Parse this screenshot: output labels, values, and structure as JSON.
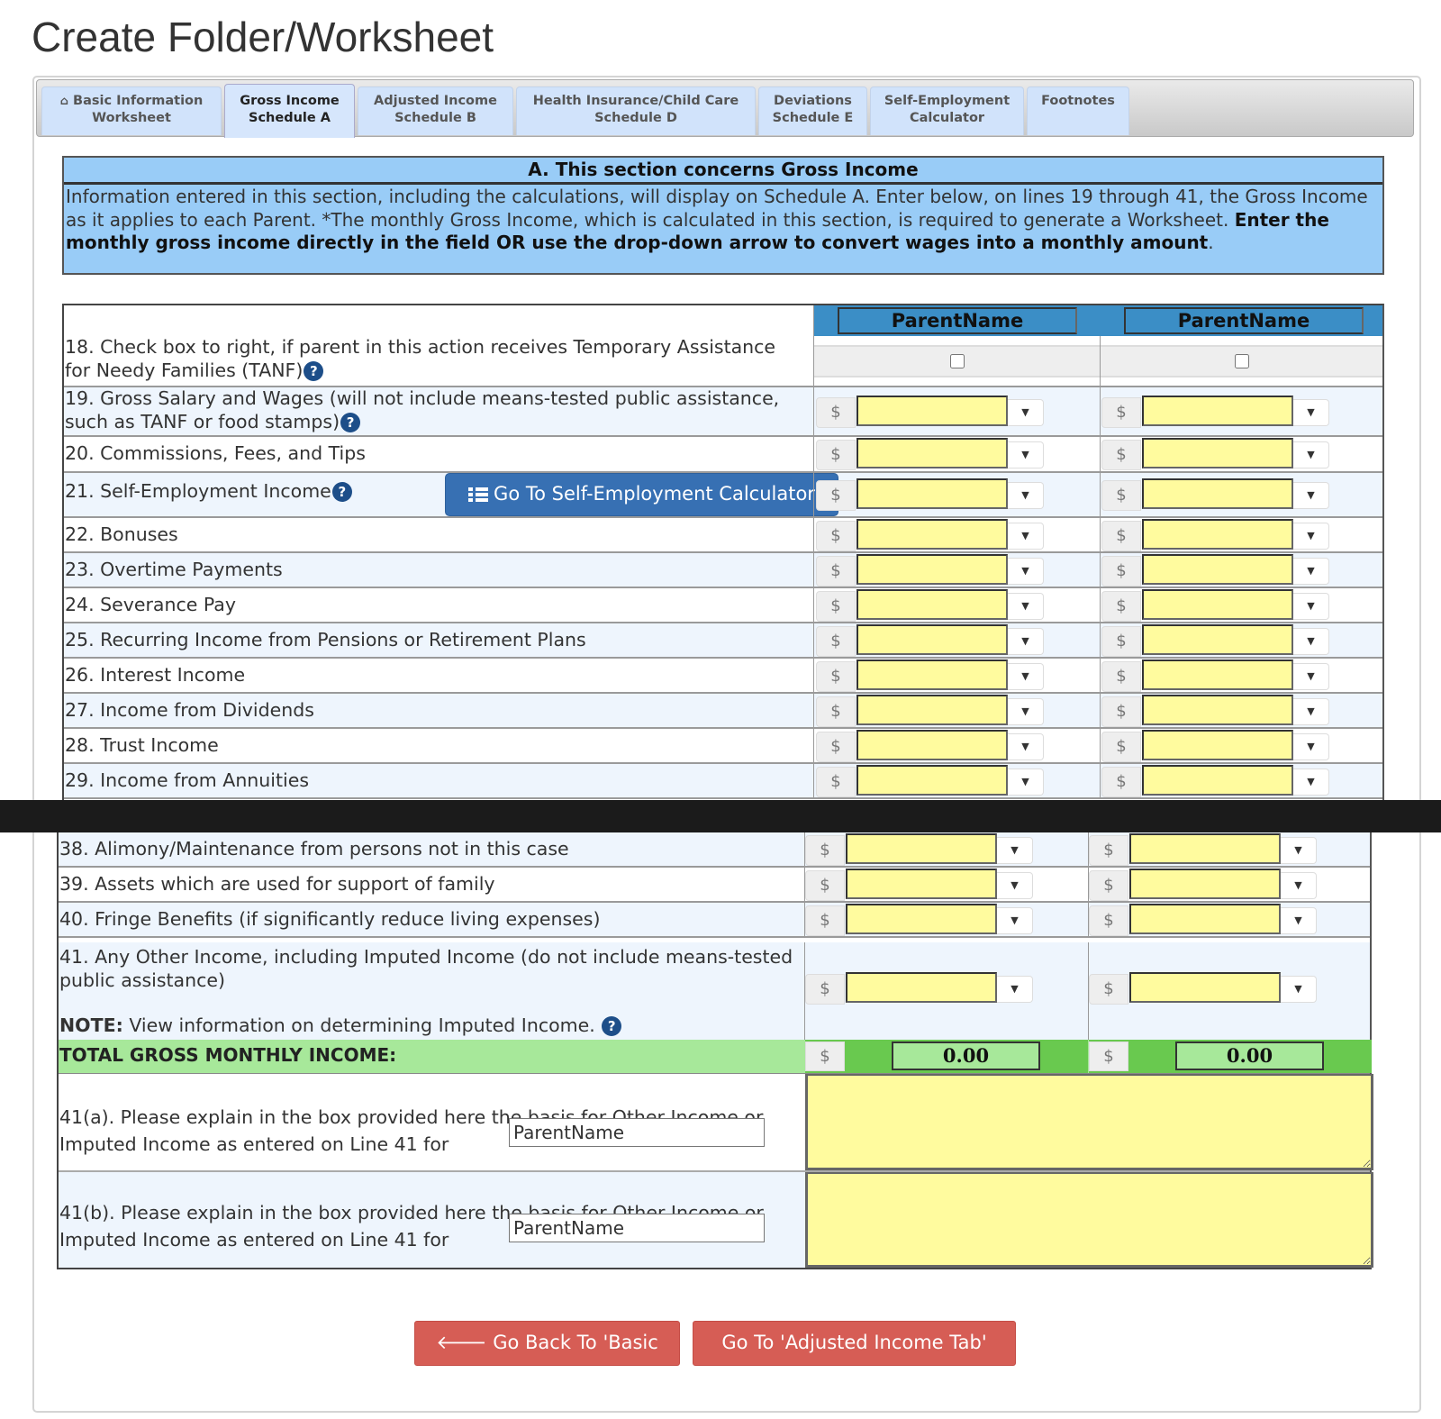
{
  "page": {
    "title": "Create Folder/Worksheet"
  },
  "tabs": [
    {
      "label_line1": "Basic Information",
      "label_line2": "Worksheet",
      "icon": "home-icon",
      "active": false
    },
    {
      "label_line1": "Gross Income",
      "label_line2": "Schedule A",
      "active": true
    },
    {
      "label_line1": "Adjusted Income",
      "label_line2": "Schedule B",
      "active": false
    },
    {
      "label_line1": "Health Insurance/Child Care",
      "label_line2": "Schedule D",
      "active": false
    },
    {
      "label_line1": "Deviations",
      "label_line2": "Schedule E",
      "active": false
    },
    {
      "label_line1": "Self-Employment",
      "label_line2": "Calculator",
      "active": false
    },
    {
      "label_line1": "Footnotes",
      "label_line2": "",
      "active": false
    }
  ],
  "section": {
    "title": "A. This section concerns Gross Income",
    "text_plain": "Information entered in this section, including the calculations, will display on Schedule A. Enter below, on lines 19 through 41, the Gross Income as it applies to each Parent. *The monthly Gross Income, which is calculated in this section, is required to generate a Worksheet.",
    "text_bold": "Enter the monthly gross income directly in the field OR use the drop-down arrow to convert wages into a monthly amount",
    "text_end": "."
  },
  "parents": [
    {
      "name": "ParentName"
    },
    {
      "name": "ParentName"
    }
  ],
  "currency_symbol": "$",
  "dropdown_glyph": "▼",
  "help_glyph": "?",
  "lines": {
    "l18": {
      "label": "18. Check box to right, if parent in this action receives Temporary Assistance for Needy Families (TANF)",
      "checked": [
        false,
        false
      ]
    },
    "l19": {
      "label": "19. Gross Salary and Wages (will not include means-tested public assistance, such as TANF or food stamps)",
      "values": [
        "",
        ""
      ]
    },
    "l20": {
      "label": "20. Commissions, Fees, and Tips",
      "values": [
        "",
        ""
      ]
    },
    "l21": {
      "label": "21. Self-Employment Income",
      "values": [
        "",
        ""
      ],
      "button": "Go To Self-Employment Calculator"
    },
    "l22": {
      "label": "22. Bonuses",
      "values": [
        "",
        ""
      ]
    },
    "l23": {
      "label": "23. Overtime Payments",
      "values": [
        "",
        ""
      ]
    },
    "l24": {
      "label": "24. Severance Pay",
      "values": [
        "",
        ""
      ]
    },
    "l25": {
      "label": "25. Recurring Income from Pensions or Retirement Plans",
      "values": [
        "",
        ""
      ]
    },
    "l26": {
      "label": "26. Interest Income",
      "values": [
        "",
        ""
      ]
    },
    "l27": {
      "label": "27. Income from Dividends",
      "values": [
        "",
        ""
      ]
    },
    "l28": {
      "label": "28. Trust Income",
      "values": [
        "",
        ""
      ]
    },
    "l29": {
      "label": "29. Income from Annuities",
      "values": [
        "",
        ""
      ]
    },
    "l38": {
      "label": "38. Alimony/Maintenance from persons not in this case",
      "values": [
        "",
        ""
      ]
    },
    "l39": {
      "label": "39. Assets which are used for support of family",
      "values": [
        "",
        ""
      ]
    },
    "l40": {
      "label": "40. Fringe Benefits (if significantly reduce living expenses)",
      "values": [
        "",
        ""
      ]
    },
    "l41": {
      "label": "41. Any Other Income, including Imputed Income (do not include means-tested public assistance)",
      "values": [
        "",
        ""
      ],
      "note_bold": "NOTE:",
      "note_text": "View information on determining Imputed Income."
    }
  },
  "total": {
    "label": "TOTAL GROSS MONTHLY INCOME:",
    "values": [
      "0.00",
      "0.00"
    ]
  },
  "explain": {
    "a": {
      "label": "41(a). Please explain in the box provided here the basis for Other Income or Imputed Income as entered on Line 41 for",
      "parent": "ParentName",
      "text": ""
    },
    "b": {
      "label": "41(b). Please explain in the box provided here the basis for Other Income or Imputed Income as entered on Line 41 for",
      "parent": "ParentName",
      "text": ""
    }
  },
  "nav": {
    "back_label": "Go Back To 'Basic Tab'",
    "next_label": "Go To 'Adjusted Income Tab'",
    "back_icon": "🡐",
    "next_icon": "🡒"
  },
  "colors": {
    "section_bg": "#99ccf7",
    "input_yellow": "#fffb9e",
    "total_green": "#69c94f",
    "total_light_green": "#a7e89a",
    "button_blue": "#3770b3",
    "button_red": "#d65d55"
  }
}
